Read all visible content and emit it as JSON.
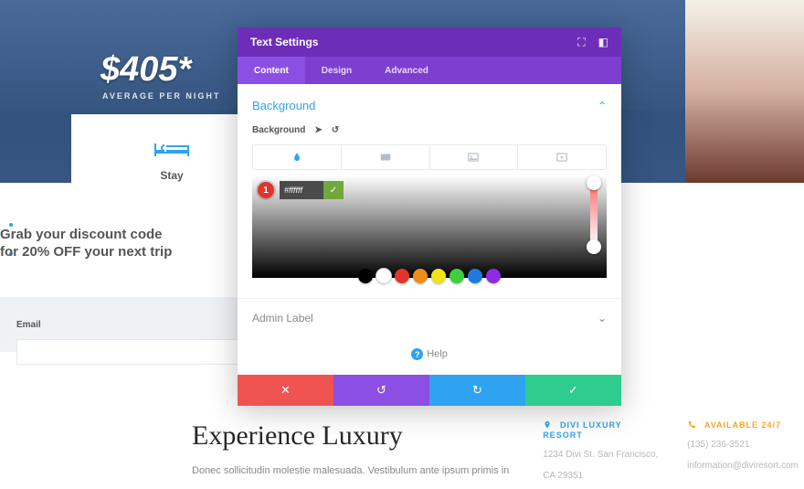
{
  "hero": {
    "price": "$405*",
    "subtitle": "AVERAGE PER NIGHT"
  },
  "stay": {
    "label": "Stay"
  },
  "discount": {
    "line1": "Grab your discount code",
    "line2": "for 20% OFF your next trip"
  },
  "email": {
    "label": "Email"
  },
  "luxury": {
    "title": "Experience Luxury",
    "body": "Donec sollicitudin molestie malesuada. Vestibulum ante ipsum primis in",
    "resort": {
      "heading": "DIVI LUXURY RESORT",
      "addr1": "1234 Divi St. San Francisco,",
      "addr2": "CA 29351"
    },
    "avail": {
      "heading": "AVAILABLE 24/7",
      "phone": "(135) 236-3521",
      "email": "information@diviresort.com"
    }
  },
  "modal": {
    "title": "Text Settings",
    "tabs": {
      "content": "Content",
      "design": "Design",
      "advanced": "Advanced"
    },
    "section": "Background",
    "bgLabel": "Background",
    "hexValue": "#ffffff",
    "swatches": [
      {
        "c": "#000000"
      },
      {
        "c": "#ffffff"
      },
      {
        "c": "#e0342c"
      },
      {
        "c": "#f08c1a"
      },
      {
        "c": "#f2e21b"
      },
      {
        "c": "#3ecf3e"
      },
      {
        "c": "#1f7ae0"
      },
      {
        "c": "#8c2be0"
      }
    ],
    "admin": "Admin Label",
    "help": "Help",
    "callout": "1"
  }
}
